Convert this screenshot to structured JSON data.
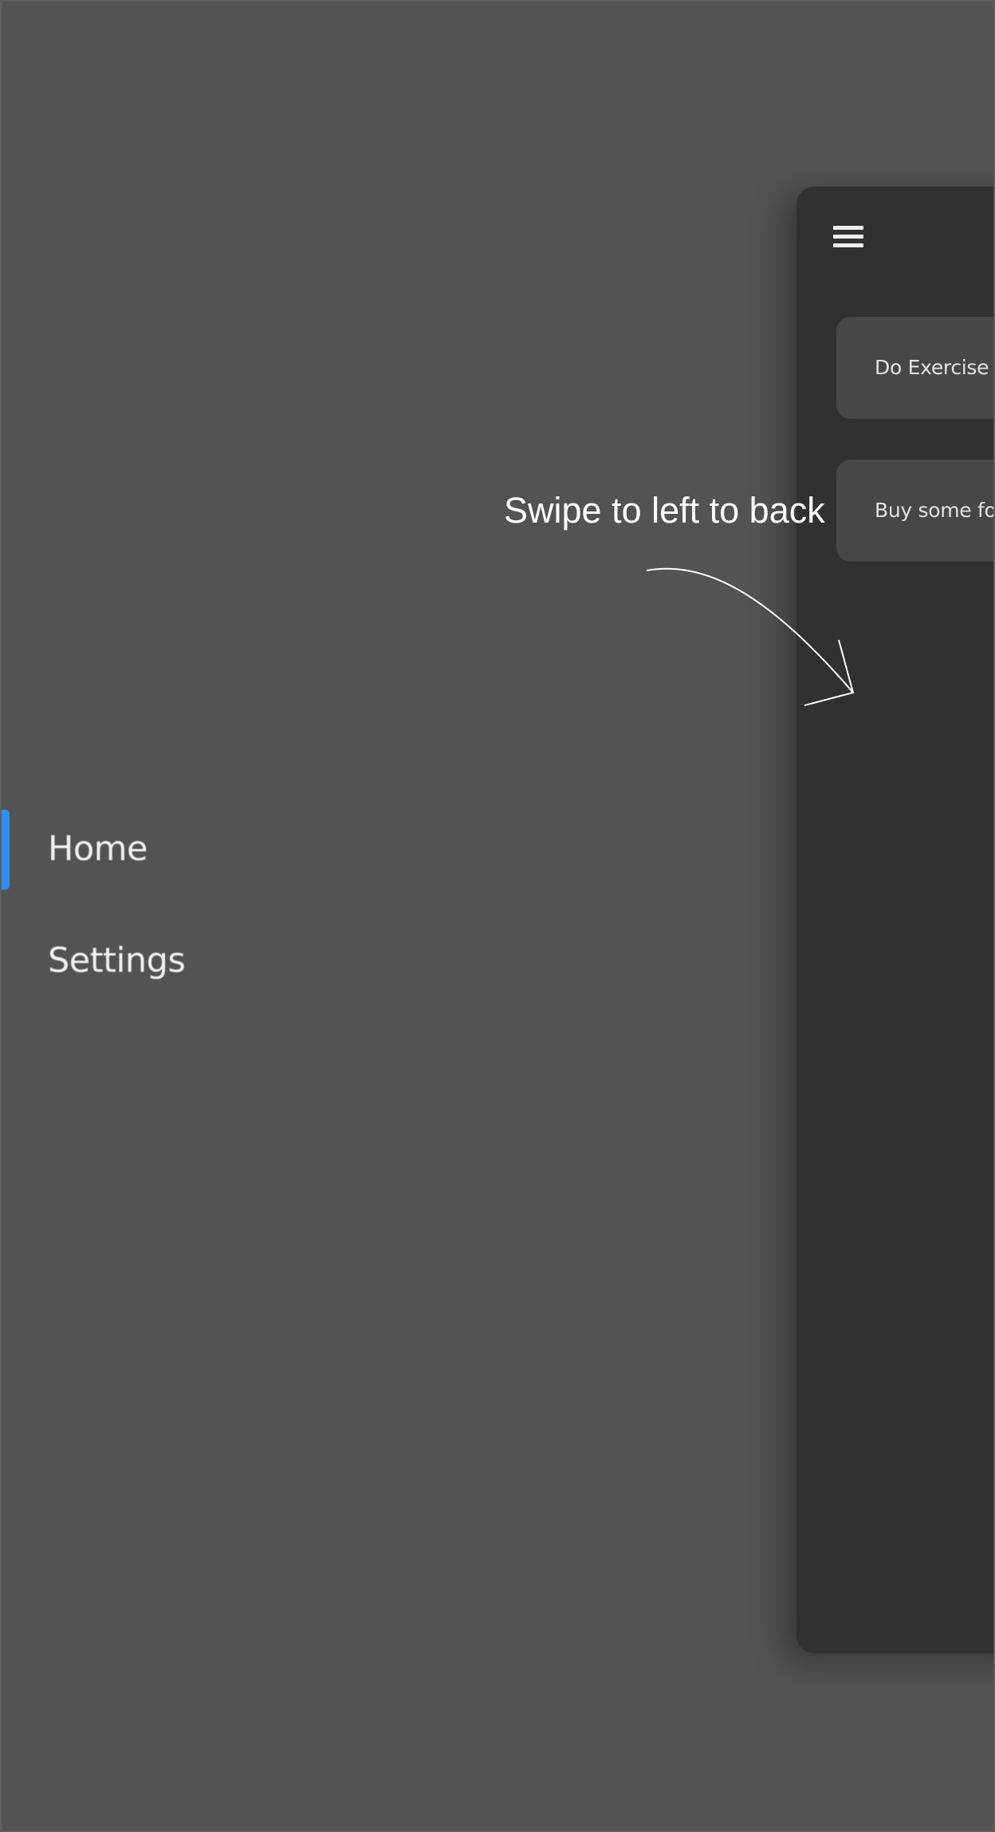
{
  "drawer": {
    "items": [
      {
        "label": "Home",
        "active": true
      },
      {
        "label": "Settings",
        "active": false
      }
    ],
    "accent_color": "#2f8ef0"
  },
  "main": {
    "menu_icon": "hamburger-menu-icon",
    "tasks": [
      {
        "label": "Do Exercise"
      },
      {
        "label": "Buy some fo"
      }
    ]
  },
  "overlay": {
    "hint_text": "Swipe to left to back",
    "arrow_icon": "curved-arrow-icon"
  }
}
